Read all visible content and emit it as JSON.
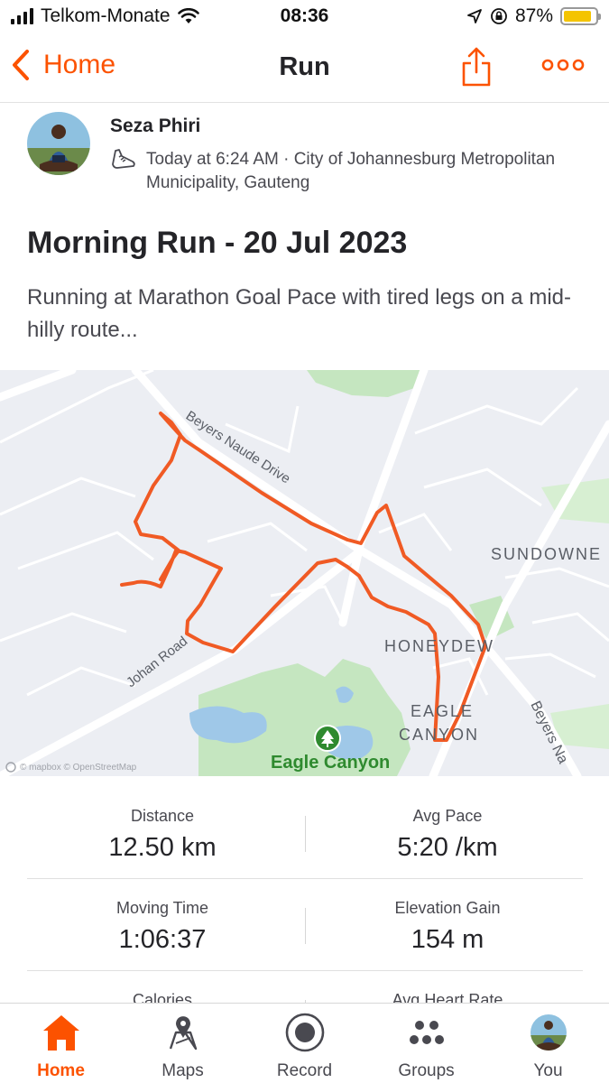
{
  "status_bar": {
    "carrier": "Telkom-Monate",
    "time": "08:36",
    "battery_pct": "87%",
    "battery_level": 0.87
  },
  "nav": {
    "back_label": "Home",
    "title": "Run",
    "accent": "#fc5200"
  },
  "athlete": {
    "name": "Seza Phiri",
    "meta": "Today at 6:24 AM · City of Johannesburg Metropolitan Municipality, Gauteng"
  },
  "activity": {
    "title": "Morning Run - 20 Jul 2023",
    "description": "Running at Marathon Goal Pace with tired legs on a mid-hilly route..."
  },
  "map": {
    "labels": {
      "road_beyers": "Beyers Naude Drive",
      "road_johan": "Johan Road",
      "sundowner": "SUNDOWNE",
      "honeydew": "HONEYDEW",
      "eagle_canyon_1": "EAGLE",
      "eagle_canyon_2": "CANYON",
      "beyers_na": "Beyers Na",
      "park": "Eagle Canyon",
      "attribution": "© mapbox © OpenStreetMap"
    },
    "route_color": "#f05a24"
  },
  "stats": [
    {
      "left": {
        "label": "Distance",
        "value": "12.50 km"
      },
      "right": {
        "label": "Avg Pace",
        "value": "5:20 /km"
      }
    },
    {
      "left": {
        "label": "Moving Time",
        "value": "1:06:37"
      },
      "right": {
        "label": "Elevation Gain",
        "value": "154 m"
      }
    },
    {
      "left": {
        "label": "Calories",
        "value": ""
      },
      "right": {
        "label": "Avg Heart Rate",
        "value": ""
      }
    }
  ],
  "tabs": [
    {
      "label": "Home",
      "icon": "home-icon",
      "active": true
    },
    {
      "label": "Maps",
      "icon": "maps-icon",
      "active": false
    },
    {
      "label": "Record",
      "icon": "record-icon",
      "active": false
    },
    {
      "label": "Groups",
      "icon": "groups-icon",
      "active": false
    },
    {
      "label": "You",
      "icon": "avatar",
      "active": false
    }
  ]
}
